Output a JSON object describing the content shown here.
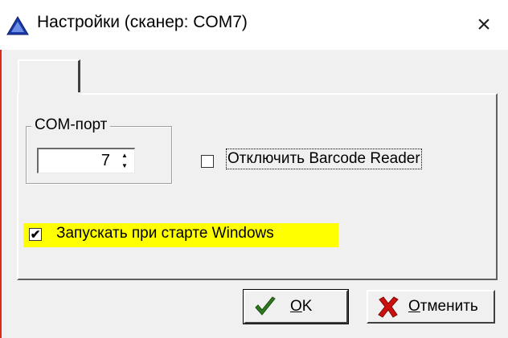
{
  "window": {
    "title": "Настройки (сканер: COM7)",
    "close_symbol": "×"
  },
  "tab": {
    "label": ""
  },
  "com_group": {
    "label": "COM-порт",
    "port_value": "7"
  },
  "options": {
    "disable_barcode": {
      "label": "Отключить Barcode Reader",
      "checked": false
    },
    "autostart": {
      "label": "Запускать при старте Windows",
      "checked": true,
      "check_mark": "✔"
    }
  },
  "buttons": {
    "ok": {
      "mnemonic": "O",
      "rest": "K",
      "icon": "checkmark-icon",
      "icon_color": "#2d7a1f"
    },
    "cancel": {
      "mnemonic": "О",
      "rest": "тменить",
      "icon": "x-icon",
      "icon_color": "#cc1010"
    }
  },
  "colors": {
    "highlight": "#ffff00",
    "title_icon": "#1a3aa8",
    "frame_accent": "#e0281e"
  }
}
